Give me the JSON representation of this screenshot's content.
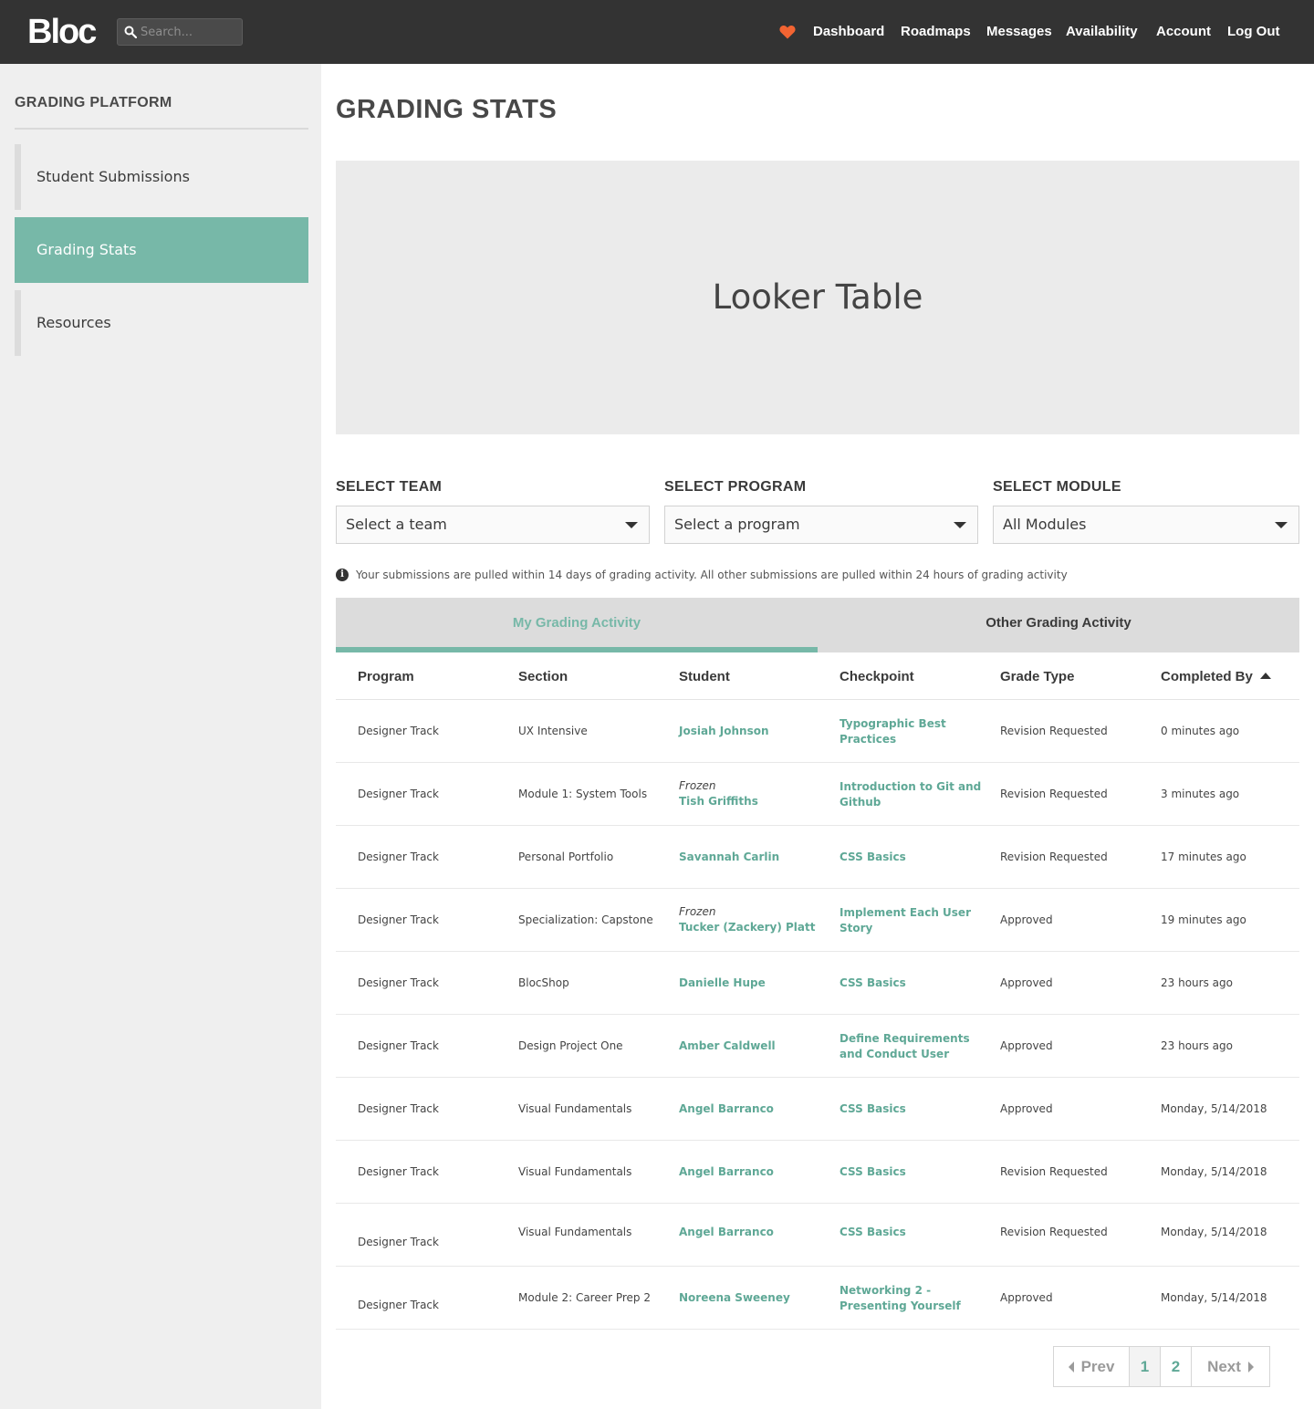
{
  "header": {
    "logo": "Bloc",
    "search_placeholder": "Search...",
    "nav": [
      "Dashboard",
      "Roadmaps",
      "Messages",
      "Availability",
      "Account",
      "Log Out"
    ],
    "accent_heart_color": "#f26432"
  },
  "sidebar": {
    "title": "GRADING PLATFORM",
    "items": [
      {
        "label": "Student Submissions",
        "active": false
      },
      {
        "label": "Grading Stats",
        "active": true
      },
      {
        "label": "Resources",
        "active": false
      }
    ],
    "active_color": "#77b8a8"
  },
  "main": {
    "title": "GRADING STATS",
    "looker_placeholder": "Looker Table",
    "filters": [
      {
        "label": "SELECT TEAM",
        "value": "Select a team"
      },
      {
        "label": "SELECT PROGRAM",
        "value": "Select a program"
      },
      {
        "label": "SELECT MODULE",
        "value": "All Modules"
      }
    ],
    "info": "Your submissions are pulled within 14 days of grading activity. All other submissions are pulled within 24 hours of grading activity",
    "tabs": [
      {
        "label": "My Grading Activity",
        "active": true
      },
      {
        "label": "Other Grading Activity",
        "active": false
      }
    ],
    "columns": [
      "Program",
      "Section",
      "Student",
      "Checkpoint",
      "Grade Type",
      "Completed By"
    ],
    "rows": [
      {
        "program": "Designer Track",
        "section": "UX Intensive",
        "frozen": "",
        "student": "Josiah Johnson",
        "checkpoint": [
          "Typographic Best",
          "Practices"
        ],
        "grade": "Revision Requested",
        "completed": "0 minutes ago"
      },
      {
        "program": "Designer Track",
        "section": "Module 1: System Tools",
        "frozen": "Frozen",
        "student": "Tish Griffiths",
        "checkpoint": [
          "Introduction to Git and",
          "Github"
        ],
        "grade": "Revision Requested",
        "completed": "3 minutes ago"
      },
      {
        "program": "Designer Track",
        "section": "Personal Portfolio",
        "frozen": "",
        "student": "Savannah Carlin",
        "checkpoint": [
          "CSS Basics",
          ""
        ],
        "grade": "Revision Requested",
        "completed": "17 minutes ago"
      },
      {
        "program": "Designer Track",
        "section": "Specialization: Capstone",
        "frozen": "Frozen",
        "student": "Tucker (Zackery) Platt",
        "checkpoint": [
          "Implement Each User",
          "Story"
        ],
        "grade": "Approved",
        "completed": "19 minutes ago"
      },
      {
        "program": "Designer Track",
        "section": "BlocShop",
        "frozen": "",
        "student": "Danielle Hupe",
        "checkpoint": [
          "CSS Basics",
          ""
        ],
        "grade": "Approved",
        "completed": "23 hours ago"
      },
      {
        "program": "Designer Track",
        "section": "Design Project One",
        "frozen": "",
        "student": "Amber Caldwell",
        "checkpoint": [
          "Define Requirements",
          "and Conduct User"
        ],
        "grade": "Approved",
        "completed": "23 hours ago"
      },
      {
        "program": "Designer Track",
        "section": "Visual Fundamentals",
        "frozen": "",
        "student": "Angel Barranco",
        "checkpoint": [
          "CSS Basics",
          ""
        ],
        "grade": "Approved",
        "completed": "Monday, 5/14/2018"
      },
      {
        "program": "Designer Track",
        "section": "Visual Fundamentals",
        "frozen": "",
        "student": "Angel Barranco",
        "checkpoint": [
          "CSS Basics",
          ""
        ],
        "grade": "Revision Requested",
        "completed": "Monday, 5/14/2018"
      },
      {
        "program": "Designer Track",
        "section": "Visual Fundamentals",
        "frozen": "",
        "student": "Angel Barranco",
        "checkpoint": [
          "CSS Basics",
          ""
        ],
        "grade": "Revision Requested",
        "completed": "Monday, 5/14/2018"
      },
      {
        "program": "Designer Track",
        "section": "Module 2: Career Prep 2",
        "frozen": "",
        "student": "Noreena Sweeney",
        "checkpoint": [
          "Networking 2 -",
          "Presenting Yourself"
        ],
        "grade": "Approved",
        "completed": "Monday, 5/14/2018"
      }
    ],
    "pagination": {
      "prev": "Prev",
      "pages": [
        "1",
        "2"
      ],
      "current": "1",
      "next": "Next"
    }
  }
}
